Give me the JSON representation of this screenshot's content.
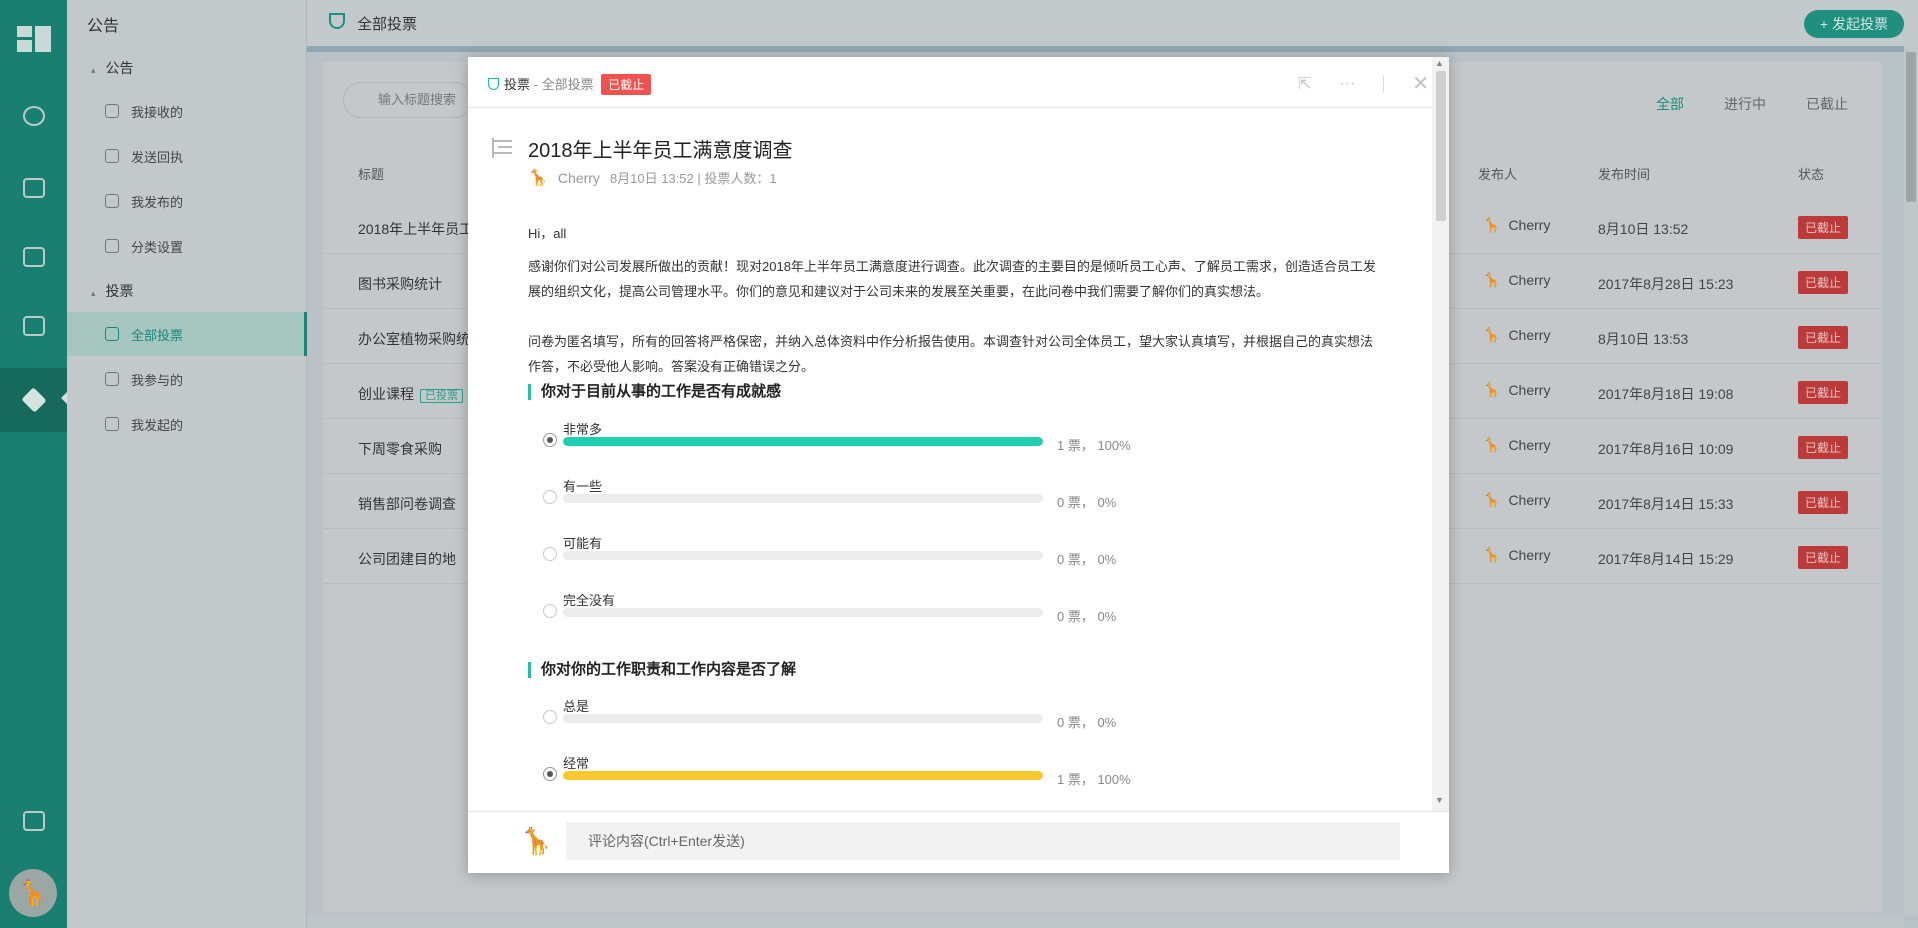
{
  "sidebar": {
    "title": "公告",
    "group1": "公告",
    "items1": [
      "我接收的",
      "发送回执",
      "我发布的",
      "分类设置"
    ],
    "group2": "投票",
    "items2": [
      "全部投票",
      "我参与的",
      "我发起的"
    ]
  },
  "topbar": {
    "title": "全部投票",
    "new_button": "+ 发起投票"
  },
  "list": {
    "search_placeholder": "输入标题搜索",
    "filters": [
      "全部",
      "进行中",
      "已截止"
    ],
    "headers": {
      "title": "标题",
      "publisher": "发布人",
      "time": "发布时间",
      "status": "状态"
    },
    "rows": [
      {
        "title": "2018年上半年员工",
        "tag": "",
        "publisher": "Cherry",
        "time": "8月10日 13:52",
        "status": "已截止"
      },
      {
        "title": "图书采购统计",
        "tag": "",
        "publisher": "Cherry",
        "time": "2017年8月28日 15:23",
        "status": "已截止"
      },
      {
        "title": "办公室植物采购统",
        "tag": "",
        "publisher": "Cherry",
        "time": "8月10日 13:53",
        "status": "已截止"
      },
      {
        "title": "创业课程",
        "tag": "已投票",
        "publisher": "Cherry",
        "time": "2017年8月18日 19:08",
        "status": "已截止"
      },
      {
        "title": "下周零食采购",
        "tag": "",
        "publisher": "Cherry",
        "time": "2017年8月16日 10:09",
        "status": "已截止"
      },
      {
        "title": "销售部问卷调查",
        "tag": "",
        "publisher": "Cherry",
        "time": "2017年8月14日 15:33",
        "status": "已截止"
      },
      {
        "title": "公司团建目的地",
        "tag": "",
        "publisher": "Cherry",
        "time": "2017年8月14日 15:29",
        "status": "已截止"
      }
    ]
  },
  "modal": {
    "crumb_main": "投票",
    "crumb_sub": " - 全部投票",
    "status_badge": "已截止",
    "title": "2018年上半年员工满意度调查",
    "author": "Cherry",
    "date": "8月10日 13:52",
    "voters": "|   投票人数：1",
    "greeting": "Hi，all",
    "para1": "感谢你们对公司发展所做出的贡献！现对2018年上半年员工满意度进行调查。此次调查的主要目的是倾听员工心声、了解员工需求，创造适合员工发展的组织文化，提高公司管理水平。你们的意见和建议对于公司未来的发展至关重要，在此问卷中我们需要了解你们的真实想法。",
    "para2": "问卷为匿名填写，所有的回答将严格保密，并纳入总体资料中作分析报告使用。本调查针对公司全体员工，望大家认真填写，并根据自己的真实想法作答，不必受他人影响。答案没有正确错误之分。",
    "questions": [
      {
        "title": "你对于目前从事的工作是否有成就感",
        "options": [
          {
            "label": "非常多",
            "result": "1 票， 100%",
            "pct": 100,
            "selected": true,
            "color": "#1fcfb2"
          },
          {
            "label": "有一些",
            "result": "0 票， 0%",
            "pct": 0,
            "selected": false,
            "color": "#1fcfb2"
          },
          {
            "label": "可能有",
            "result": "0 票， 0%",
            "pct": 0,
            "selected": false,
            "color": "#1fcfb2"
          },
          {
            "label": "完全没有",
            "result": "0 票， 0%",
            "pct": 0,
            "selected": false,
            "color": "#1fcfb2"
          }
        ]
      },
      {
        "title": "你对你的工作职责和工作内容是否了解",
        "options": [
          {
            "label": "总是",
            "result": "0 票， 0%",
            "pct": 0,
            "selected": false,
            "color": "#f8c92c"
          },
          {
            "label": "经常",
            "result": "1 票， 100%",
            "pct": 100,
            "selected": true,
            "color": "#f8c92c"
          }
        ]
      }
    ],
    "comment_placeholder": "评论内容(Ctrl+Enter发送)"
  }
}
